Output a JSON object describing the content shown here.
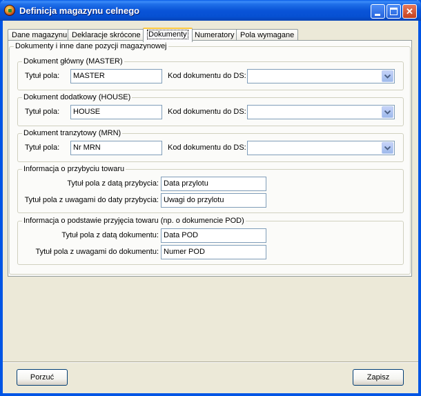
{
  "window": {
    "title": "Definicja magazynu celnego"
  },
  "tabs": [
    {
      "label": "Dane magazynu",
      "active": false
    },
    {
      "label": "Deklaracje skrócone",
      "active": false
    },
    {
      "label": "Dokumenty",
      "active": true
    },
    {
      "label": "Numeratory",
      "active": false
    },
    {
      "label": "Pola wymagane",
      "active": false
    }
  ],
  "main_group": {
    "legend": "Dokumenty i inne dane pozycji magazynowej"
  },
  "master": {
    "legend": "Dokument główny (MASTER)",
    "field_label": "Tytuł pola:",
    "field_value": "MASTER",
    "code_label": "Kod dokumentu do DS:",
    "code_value": ""
  },
  "house": {
    "legend": "Dokument dodatkowy (HOUSE)",
    "field_label": "Tytuł pola:",
    "field_value": "HOUSE",
    "code_label": "Kod dokumentu do DS:",
    "code_value": ""
  },
  "mrn": {
    "legend": "Dokument tranzytowy (MRN)",
    "field_label": "Tytuł pola:",
    "field_value": "Nr MRN",
    "code_label": "Kod dokumentu do DS:",
    "code_value": ""
  },
  "arrival": {
    "legend": "Informacja o przybyciu towaru",
    "date_label": "Tytuł pola z datą przybycia:",
    "date_value": "Data przylotu",
    "notes_label": "Tytuł pola z uwagami do daty przybycia:",
    "notes_value": "Uwagi do przylotu"
  },
  "pod": {
    "legend": "Informacja o podstawie przyjęcia towaru (np. o dokumencie POD)",
    "date_label": "Tytuł pola z datą dokumentu:",
    "date_value": "Data POD",
    "notes_label": "Tytuł pola z uwagami do dokumentu:",
    "notes_value": "Numer POD"
  },
  "footer": {
    "cancel_label": "Porzuć",
    "save_label": "Zapisz"
  },
  "icons": {
    "app": "app-icon",
    "minimize": "minimize-icon",
    "maximize": "maximize-icon",
    "close": "close-icon",
    "dropdown": "chevron-down-icon"
  },
  "colors": {
    "titlebar": "#0a54d8",
    "active_tab_accent": "#ffc83c",
    "window_bg": "#ece9d8",
    "input_border": "#7f9db9"
  }
}
